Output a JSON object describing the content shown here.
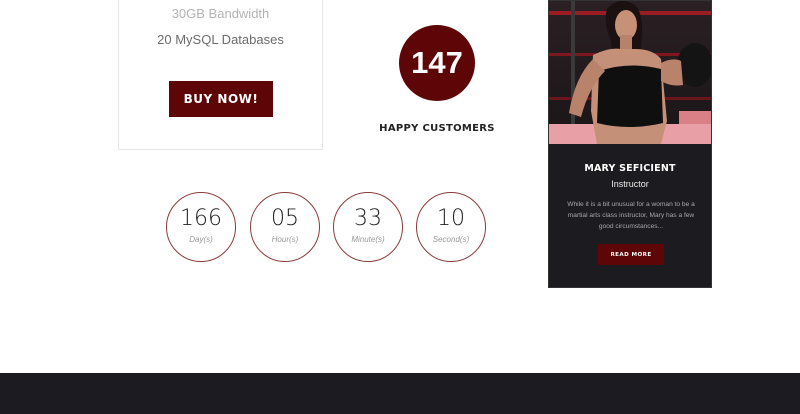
{
  "pricing": {
    "features": [
      "30GB Bandwidth",
      "20 MySQL Databases"
    ],
    "buy_label": "BUY NOW!"
  },
  "counter": {
    "value": "147",
    "label": "HAPPY CUSTOMERS"
  },
  "countdown": [
    {
      "value": "166",
      "unit": "Day(s)"
    },
    {
      "value": "05",
      "unit": "Hour(s)"
    },
    {
      "value": "33",
      "unit": "Minute(s)"
    },
    {
      "value": "10",
      "unit": "Second(s)"
    }
  ],
  "instructor": {
    "name": "MARY SEFICIENT",
    "role": "Instructor",
    "bio": "While it is a bit unusual for a woman to be a martial arts class instructor, Mary has a few good circumstances...",
    "read_more_label": "READ MORE"
  },
  "colors": {
    "accent": "#5e0607",
    "dark": "#1b1b21"
  }
}
